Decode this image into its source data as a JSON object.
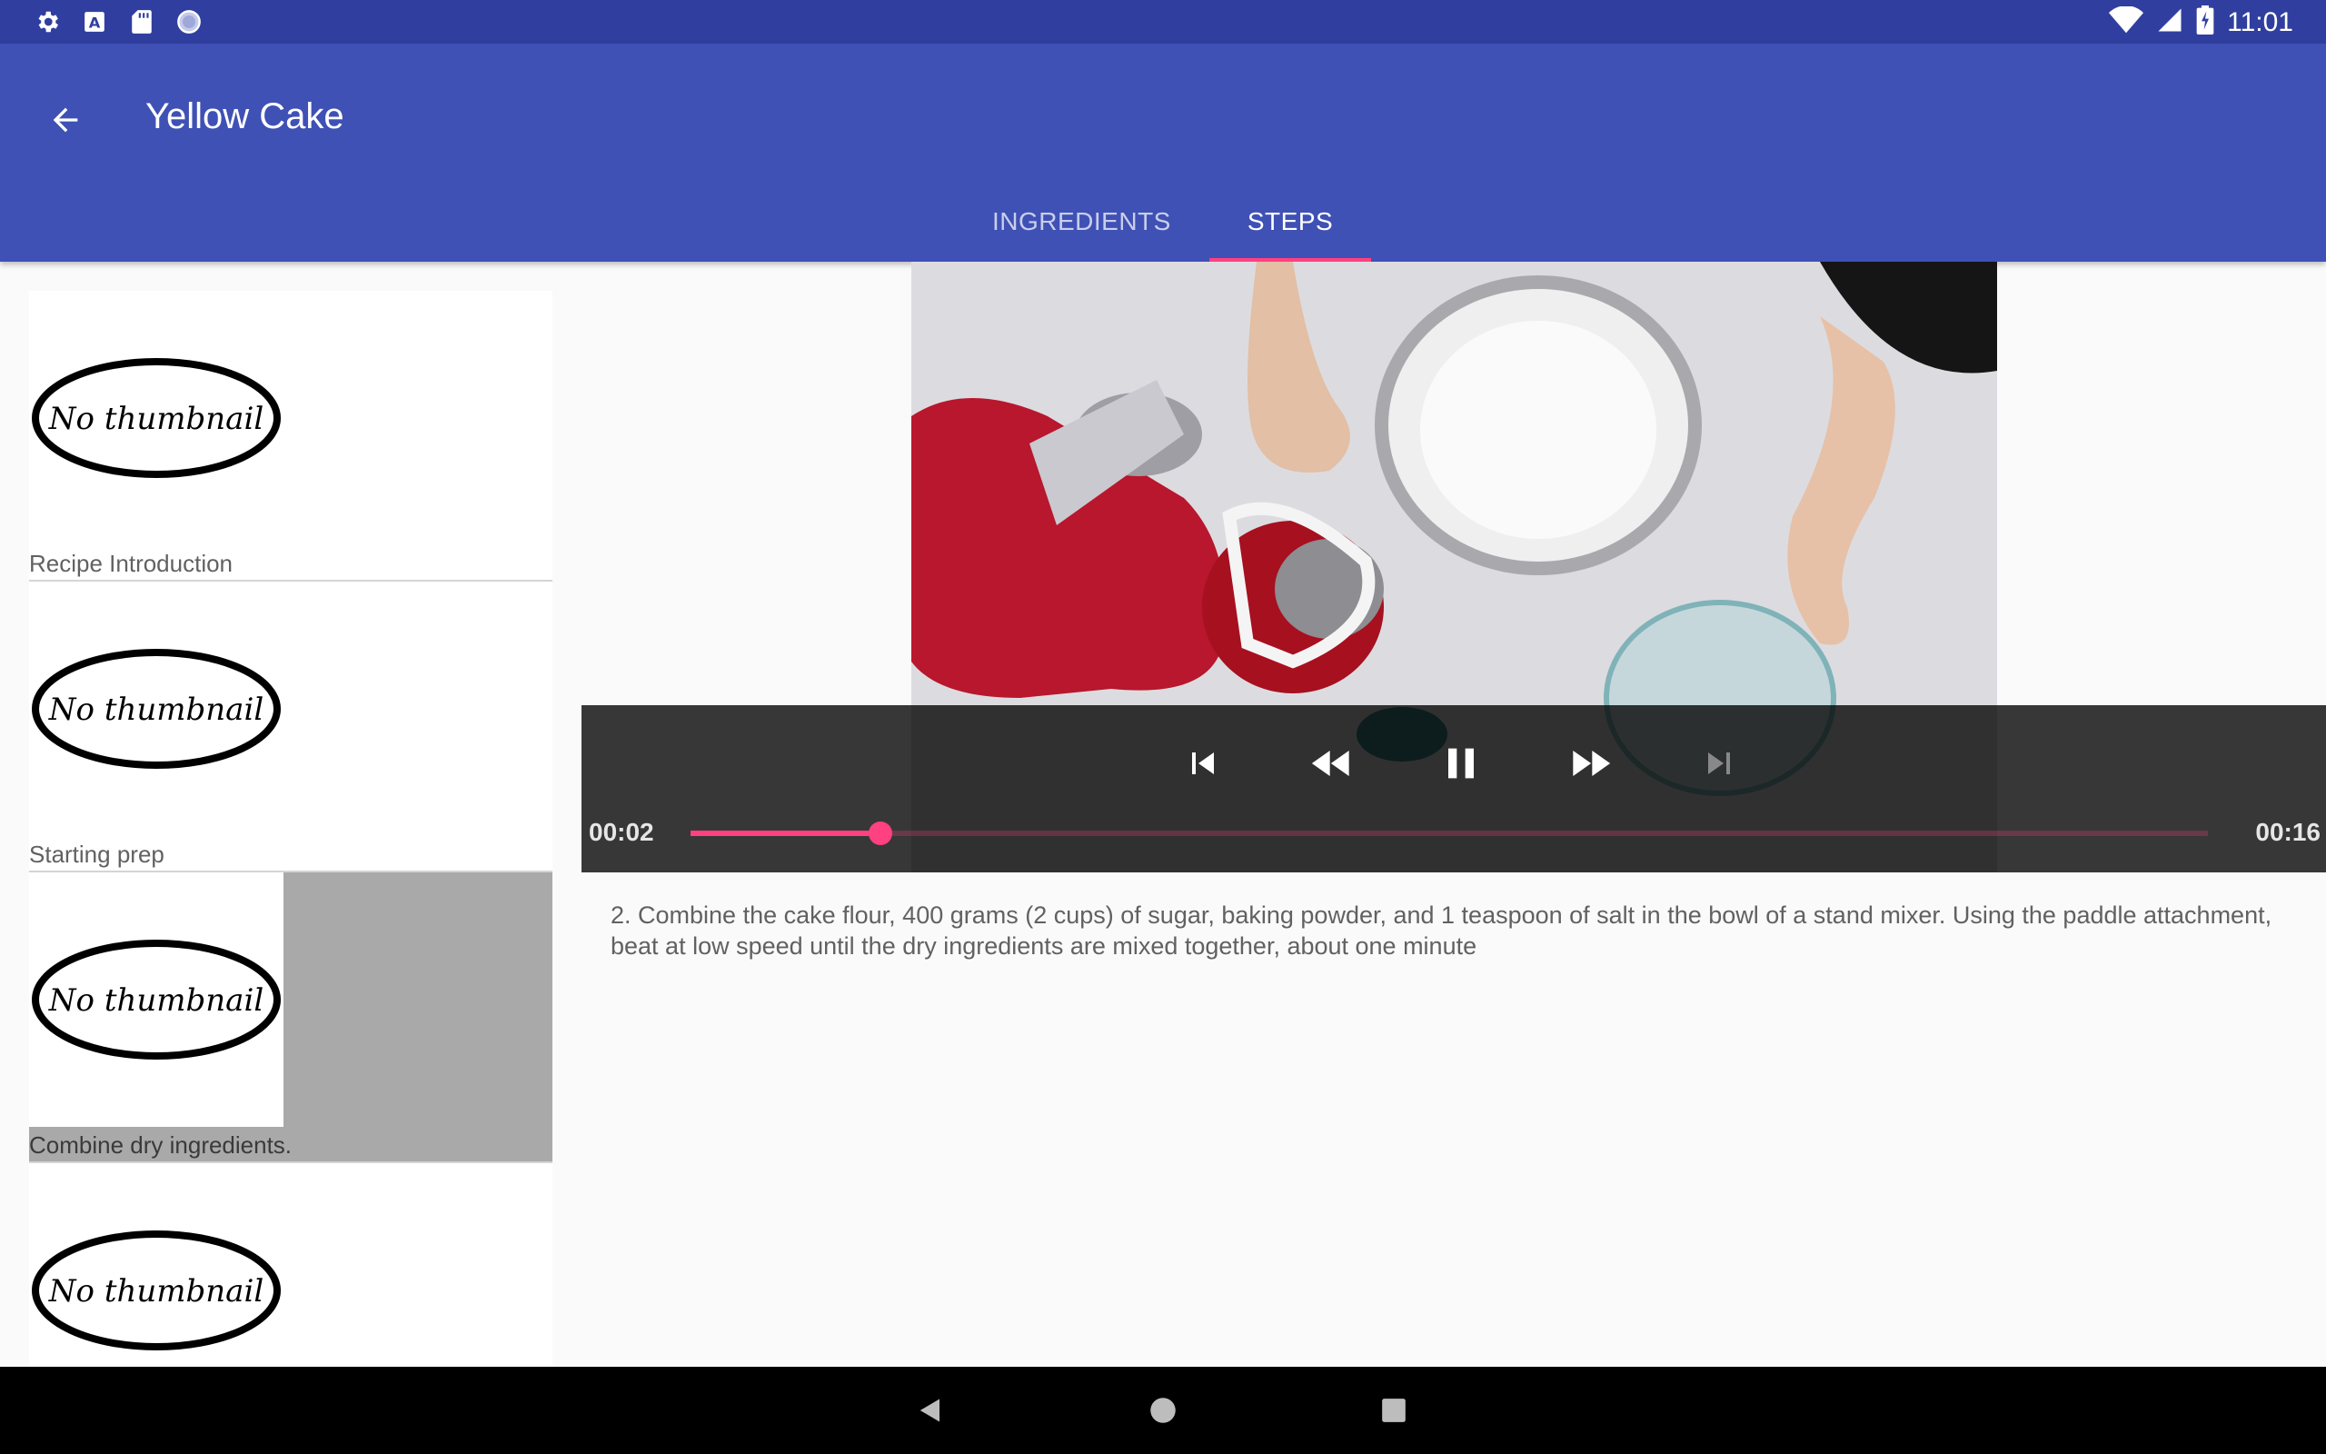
{
  "status_bar": {
    "time": "11:01",
    "left_icons": [
      "settings-icon",
      "a-box-icon",
      "sd-card-icon",
      "sync-circle-icon"
    ],
    "right_icons": [
      "wifi-icon",
      "signal-icon",
      "battery-icon"
    ]
  },
  "app_bar": {
    "title": "Yellow Cake",
    "back_icon": "arrow-back-icon",
    "tabs": [
      {
        "label": "INGREDIENTS",
        "active": false
      },
      {
        "label": "STEPS",
        "active": true
      }
    ],
    "accent": "#ff4081",
    "primary": "#3f51b5",
    "primary_dark": "#303f9f"
  },
  "steps": [
    {
      "thumbnail_text": "No thumbnail",
      "label": "Recipe Introduction",
      "selected": false
    },
    {
      "thumbnail_text": "No thumbnail",
      "label": "Starting prep",
      "selected": false
    },
    {
      "thumbnail_text": "No thumbnail",
      "label": "Combine dry ingredients.",
      "selected": true
    },
    {
      "thumbnail_text": "No thumbnail",
      "label": "",
      "selected": false
    }
  ],
  "player": {
    "position": "00:02",
    "duration": "00:16",
    "progress_fraction": 0.125,
    "controls": [
      "skip-previous-icon",
      "rewind-icon",
      "pause-icon",
      "fast-forward-icon",
      "skip-next-icon"
    ]
  },
  "description": "2. Combine the cake flour, 400 grams (2 cups) of sugar, baking powder, and 1 teaspoon of salt in the bowl of a stand mixer. Using the paddle attachment, beat at low speed until the dry ingredients are mixed together, about one minute",
  "nav_bar": {
    "buttons": [
      "back-triangle-icon",
      "home-circle-icon",
      "recents-square-icon"
    ]
  }
}
